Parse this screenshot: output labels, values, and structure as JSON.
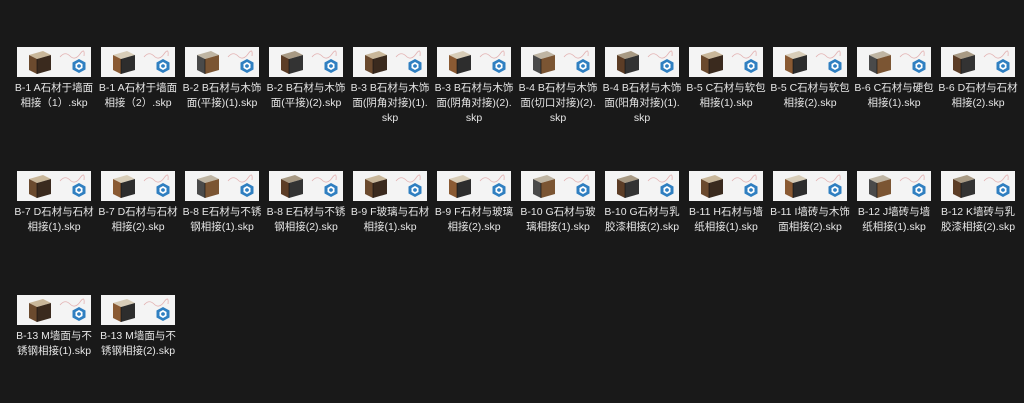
{
  "view": "file-thumbnail-grid",
  "colors": {
    "background": "#191919",
    "label_text": "#e6e6e6",
    "thumbnail_bg": "#f4f4f4",
    "skp_badge": "#2f7fc1"
  },
  "files": [
    {
      "label": "B-1 A石材于墙面相接（1）.skp",
      "icon": "sketchup-file-icon"
    },
    {
      "label": "B-1 A石材于墙面相接（2）.skp",
      "icon": "sketchup-file-icon"
    },
    {
      "label": "B-2 B石材与木饰面(平接)(1).skp",
      "icon": "sketchup-file-icon"
    },
    {
      "label": "B-2 B石材与木饰面(平接)(2).skp",
      "icon": "sketchup-file-icon"
    },
    {
      "label": "B-3 B石材与木饰面(阴角对接)(1).skp",
      "icon": "sketchup-file-icon"
    },
    {
      "label": "B-3 B石材与木饰面(阴角对接)(2).skp",
      "icon": "sketchup-file-icon"
    },
    {
      "label": "B-4 B石材与木饰面(切口对接)(2).skp",
      "icon": "sketchup-file-icon"
    },
    {
      "label": "B-4 B石材与木饰面(阳角对接)(1).skp",
      "icon": "sketchup-file-icon"
    },
    {
      "label": "B-5 C石材与软包相接(1).skp",
      "icon": "sketchup-file-icon"
    },
    {
      "label": "B-5 C石材与软包相接(2).skp",
      "icon": "sketchup-file-icon"
    },
    {
      "label": "B-6 C石材与硬包相接(1).skp",
      "icon": "sketchup-file-icon"
    },
    {
      "label": "B-6 D石材与石材相接(2).skp",
      "icon": "sketchup-file-icon"
    },
    {
      "label": "B-7 D石材与石材相接(1).skp",
      "icon": "sketchup-file-icon"
    },
    {
      "label": "B-7 D石材与石材相接(2).skp",
      "icon": "sketchup-file-icon"
    },
    {
      "label": "B-8 E石材与不锈钢相接(1).skp",
      "icon": "sketchup-file-icon"
    },
    {
      "label": "B-8 E石材与不锈钢相接(2).skp",
      "icon": "sketchup-file-icon"
    },
    {
      "label": "B-9 F玻璃与石材相接(1).skp",
      "icon": "sketchup-file-icon"
    },
    {
      "label": "B-9 F石材与玻璃相接(2).skp",
      "icon": "sketchup-file-icon"
    },
    {
      "label": "B-10 G石材与玻璃相接(1).skp",
      "icon": "sketchup-file-icon"
    },
    {
      "label": "B-10 G石材与乳胶漆相接(2).skp",
      "icon": "sketchup-file-icon"
    },
    {
      "label": "B-11 H石材与墙纸相接(1).skp",
      "icon": "sketchup-file-icon"
    },
    {
      "label": "B-11 I墙砖与木饰面相接(2).skp",
      "icon": "sketchup-file-icon"
    },
    {
      "label": "B-12 J墙砖与墙纸相接(1).skp",
      "icon": "sketchup-file-icon"
    },
    {
      "label": "B-12 K墙砖与乳胶漆相接(2).skp",
      "icon": "sketchup-file-icon"
    },
    {
      "label": "B-13 M墙面与不锈钢相接(1).skp",
      "icon": "sketchup-file-icon"
    },
    {
      "label": "B-13 M墙面与不锈钢相接(2).skp",
      "icon": "sketchup-file-icon"
    }
  ]
}
